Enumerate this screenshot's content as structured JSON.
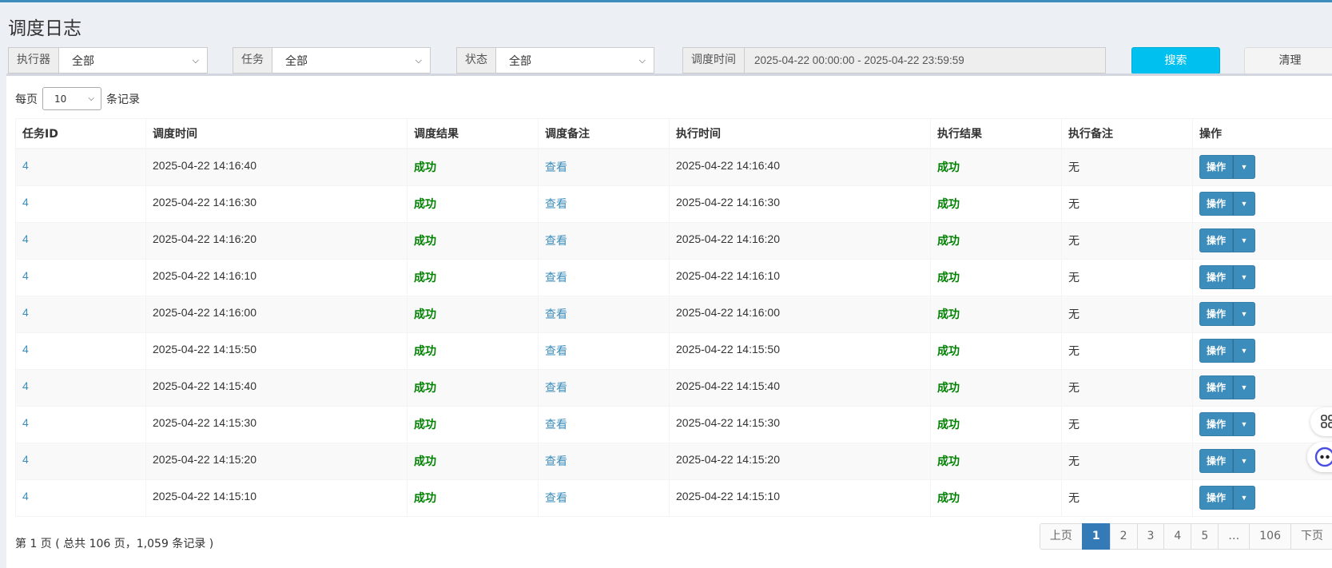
{
  "page": {
    "title": "调度日志"
  },
  "filters": {
    "executor": {
      "label": "执行器",
      "value": "全部"
    },
    "job": {
      "label": "任务",
      "value": "全部"
    },
    "status": {
      "label": "状态",
      "value": "全部"
    },
    "time": {
      "label": "调度时间",
      "value": "2025-04-22 00:00:00 - 2025-04-22 23:59:59"
    },
    "search_label": "搜索",
    "clear_label": "清理"
  },
  "length": {
    "prefix": "每页",
    "value": "10",
    "suffix": "条记录"
  },
  "table": {
    "columns": [
      "任务ID",
      "调度时间",
      "调度结果",
      "调度备注",
      "执行时间",
      "执行结果",
      "执行备注",
      "操作"
    ],
    "rows": [
      {
        "id": "4",
        "trigger_time": "2025-04-22 14:16:40",
        "trigger_result": "成功",
        "trigger_msg": "查看",
        "handle_time": "2025-04-22 14:16:40",
        "handle_result": "成功",
        "handle_msg": "无",
        "action": "操作"
      },
      {
        "id": "4",
        "trigger_time": "2025-04-22 14:16:30",
        "trigger_result": "成功",
        "trigger_msg": "查看",
        "handle_time": "2025-04-22 14:16:30",
        "handle_result": "成功",
        "handle_msg": "无",
        "action": "操作"
      },
      {
        "id": "4",
        "trigger_time": "2025-04-22 14:16:20",
        "trigger_result": "成功",
        "trigger_msg": "查看",
        "handle_time": "2025-04-22 14:16:20",
        "handle_result": "成功",
        "handle_msg": "无",
        "action": "操作"
      },
      {
        "id": "4",
        "trigger_time": "2025-04-22 14:16:10",
        "trigger_result": "成功",
        "trigger_msg": "查看",
        "handle_time": "2025-04-22 14:16:10",
        "handle_result": "成功",
        "handle_msg": "无",
        "action": "操作"
      },
      {
        "id": "4",
        "trigger_time": "2025-04-22 14:16:00",
        "trigger_result": "成功",
        "trigger_msg": "查看",
        "handle_time": "2025-04-22 14:16:00",
        "handle_result": "成功",
        "handle_msg": "无",
        "action": "操作"
      },
      {
        "id": "4",
        "trigger_time": "2025-04-22 14:15:50",
        "trigger_result": "成功",
        "trigger_msg": "查看",
        "handle_time": "2025-04-22 14:15:50",
        "handle_result": "成功",
        "handle_msg": "无",
        "action": "操作"
      },
      {
        "id": "4",
        "trigger_time": "2025-04-22 14:15:40",
        "trigger_result": "成功",
        "trigger_msg": "查看",
        "handle_time": "2025-04-22 14:15:40",
        "handle_result": "成功",
        "handle_msg": "无",
        "action": "操作"
      },
      {
        "id": "4",
        "trigger_time": "2025-04-22 14:15:30",
        "trigger_result": "成功",
        "trigger_msg": "查看",
        "handle_time": "2025-04-22 14:15:30",
        "handle_result": "成功",
        "handle_msg": "无",
        "action": "操作"
      },
      {
        "id": "4",
        "trigger_time": "2025-04-22 14:15:20",
        "trigger_result": "成功",
        "trigger_msg": "查看",
        "handle_time": "2025-04-22 14:15:20",
        "handle_result": "成功",
        "handle_msg": "无",
        "action": "操作"
      },
      {
        "id": "4",
        "trigger_time": "2025-04-22 14:15:10",
        "trigger_result": "成功",
        "trigger_msg": "查看",
        "handle_time": "2025-04-22 14:15:10",
        "handle_result": "成功",
        "handle_msg": "无",
        "action": "操作"
      }
    ]
  },
  "info": "第 1 页 ( 总共 106 页，1,059 条记录 )",
  "pagination": {
    "prev": "上页",
    "pages": [
      "1",
      "2",
      "3",
      "4",
      "5",
      "…",
      "106"
    ],
    "active": "1",
    "next": "下页"
  },
  "colors": {
    "accent": "#3c8dbc",
    "search_button": "#00c0ef",
    "success_text": "#008000",
    "page_background": "#ecf0f5",
    "active_page": "#337ab7"
  },
  "icons": [
    "chevron-down-icon",
    "dropdown-caret-icon",
    "grid-icon",
    "assistant-robot-icon"
  ]
}
